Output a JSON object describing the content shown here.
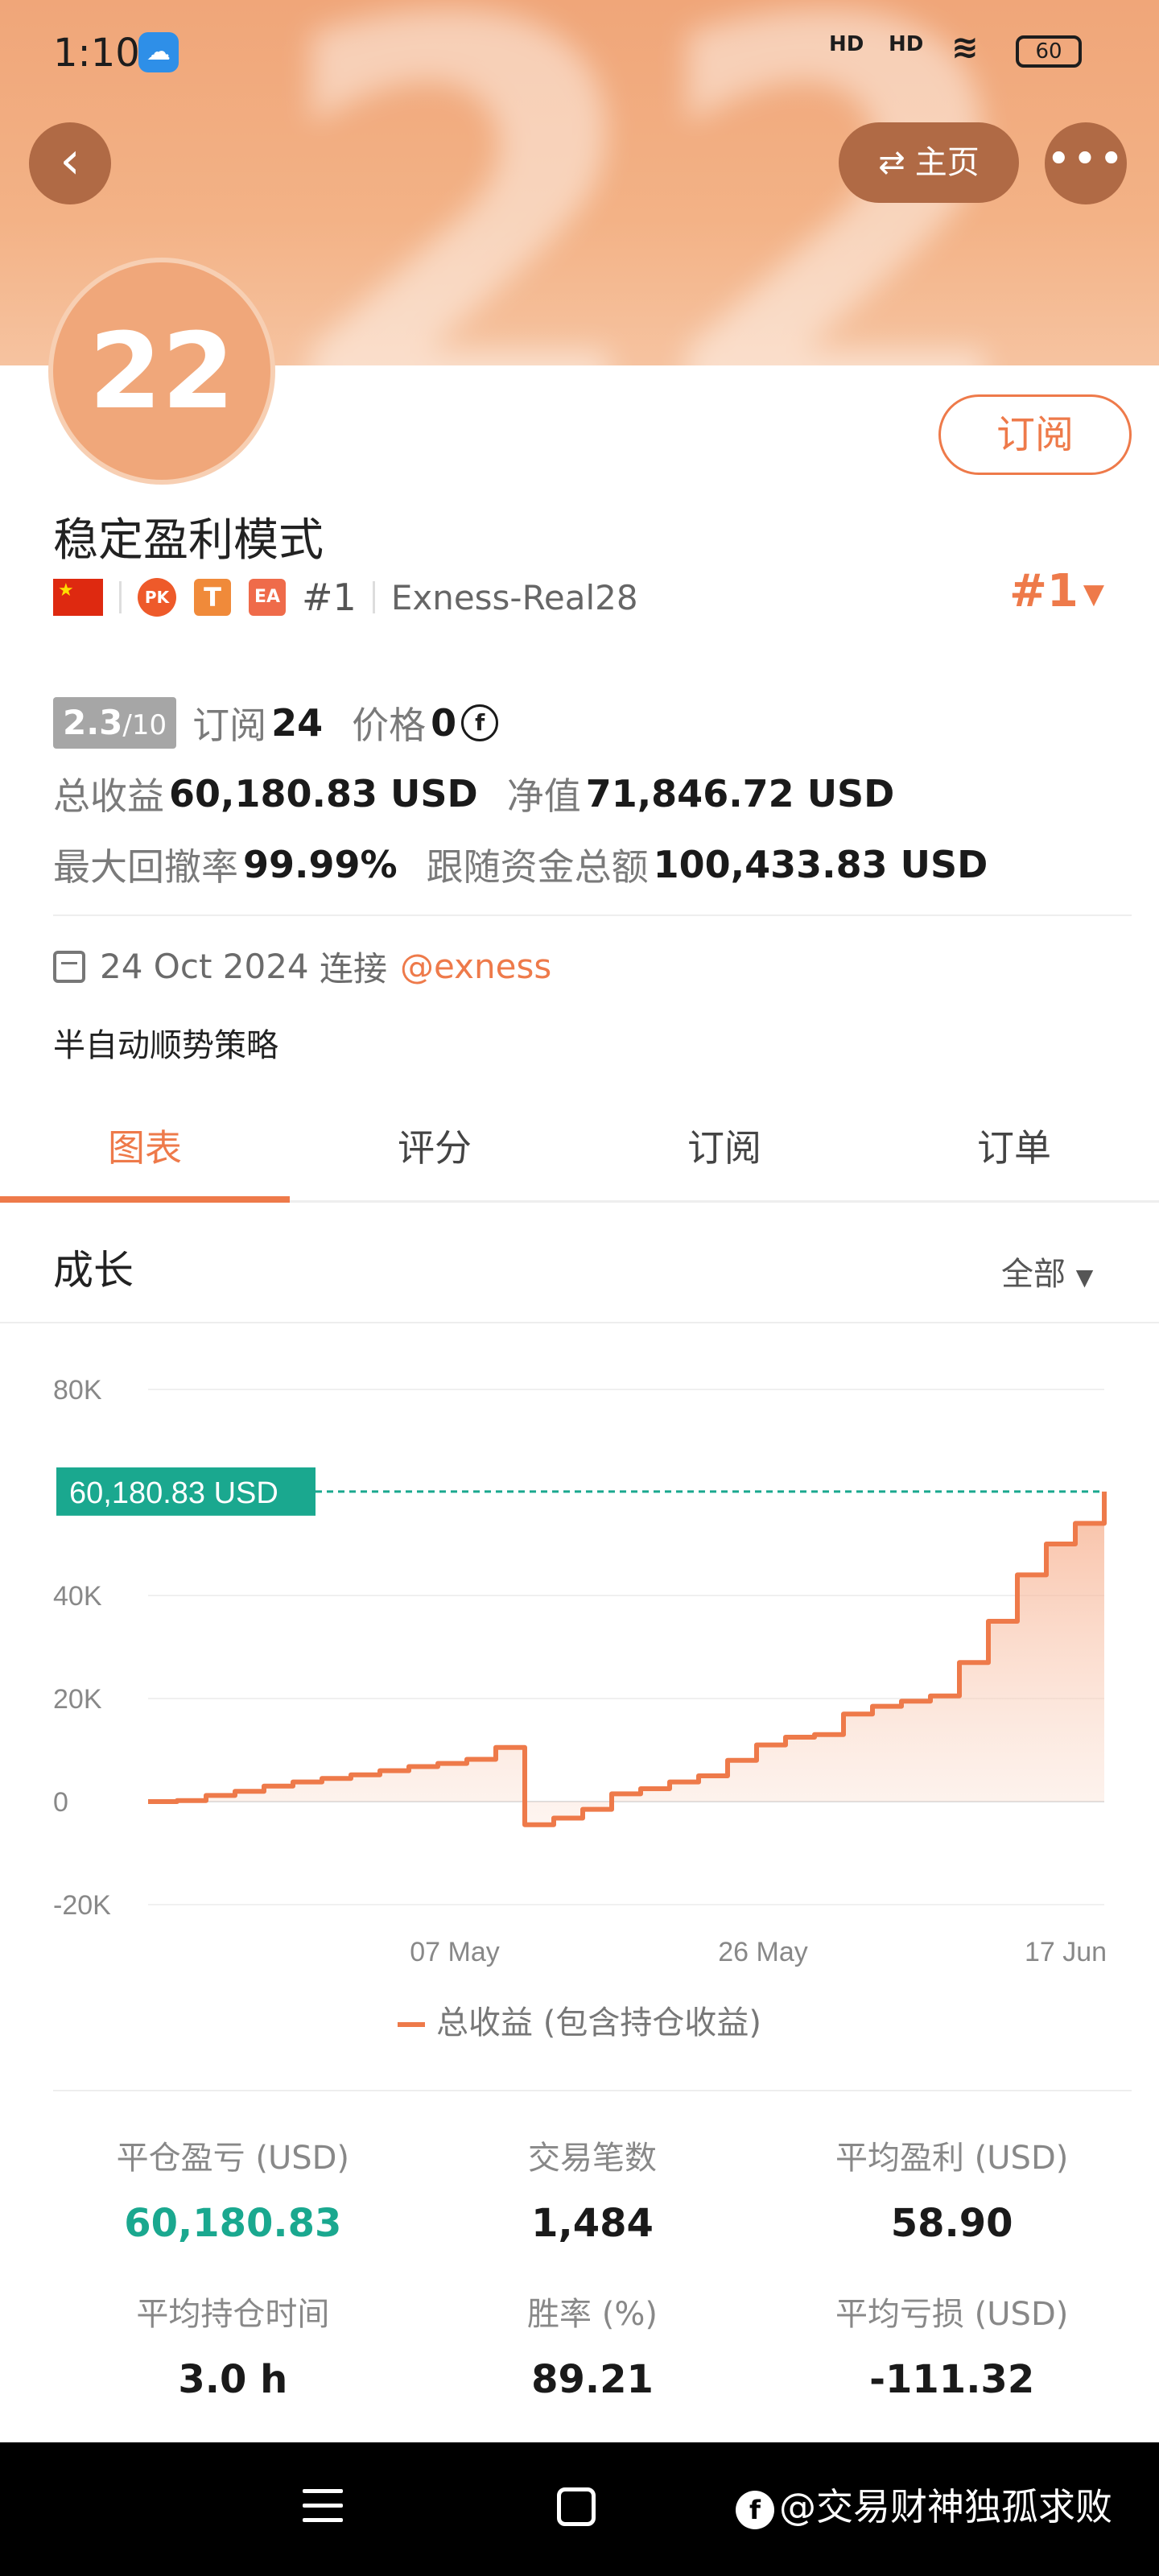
{
  "status_bar": {
    "time": "1:10",
    "battery": "60",
    "signal_1": "HD",
    "signal_2": "HD"
  },
  "header": {
    "home_label": "主页",
    "avatar_text": "22"
  },
  "profile": {
    "subscribe_label": "订阅",
    "title": "稳定盈利模式",
    "badges": {
      "pk": "PK",
      "t": "T",
      "ea": "EA"
    },
    "rank": "#1",
    "broker": "Exness-Real28",
    "rank_right": "#1"
  },
  "stats": {
    "rating": "2.3",
    "rating_of": "/10",
    "subscribe_label": "订阅",
    "subscribe_count": "24",
    "price_label": "价格",
    "price_value": "0",
    "total_profit_label": "总收益",
    "total_profit_value": "60,180.83 USD",
    "equity_label": "净值",
    "equity_value": "71,846.72 USD",
    "max_drawdown_label": "最大回撤率",
    "max_drawdown_value": "99.99%",
    "follow_funds_label": "跟随资金总额",
    "follow_funds_value": "100,433.83 USD"
  },
  "connect": {
    "date": "24 Oct 2024",
    "text": "连接",
    "handle": "@exness"
  },
  "strategy": "半自动顺势策略",
  "tabs": [
    {
      "label": "图表"
    },
    {
      "label": "评分"
    },
    {
      "label": "订阅"
    },
    {
      "label": "订单"
    }
  ],
  "section": {
    "title": "成长",
    "filter": "全部"
  },
  "colors": {
    "accent": "#ee7a4a",
    "green": "#1aa88f",
    "marker": "#1aa88f"
  },
  "chart_data": {
    "type": "area",
    "y_ticks": [
      "80K",
      "40K",
      "20K",
      "0",
      "-20K"
    ],
    "x_ticks": [
      "07 May",
      "26 May",
      "17 Jun"
    ],
    "current_label": "60,180.83 USD",
    "current_value": 60180.83,
    "ylim": [
      -20000,
      80000
    ],
    "series": [
      {
        "name": "总收益 (包含持仓收益)",
        "values": [
          0,
          200,
          1200,
          2000,
          3000,
          3800,
          4500,
          5200,
          6000,
          6800,
          7400,
          8200,
          10500,
          -4500,
          -3200,
          -1500,
          1500,
          2500,
          3800,
          5000,
          8000,
          11000,
          12500,
          13000,
          17000,
          18500,
          19500,
          20500,
          27000,
          35000,
          44000,
          50000,
          54000,
          60180
        ]
      }
    ],
    "legend_position": "bottom",
    "grid": true
  },
  "legend_label": "总收益 (包含持仓收益)",
  "metrics": [
    {
      "label": "平仓盈亏 (USD)",
      "value": "60,180.83",
      "green": true
    },
    {
      "label": "交易笔数",
      "value": "1,484"
    },
    {
      "label": "平均盈利 (USD)",
      "value": "58.90"
    },
    {
      "label": "平均持仓时间",
      "value": "3.0 h"
    },
    {
      "label": "胜率 (%)",
      "value": "89.21"
    },
    {
      "label": "平均亏损 (USD)",
      "value": "-111.32"
    }
  ],
  "watermark": "@交易财神独孤求败"
}
